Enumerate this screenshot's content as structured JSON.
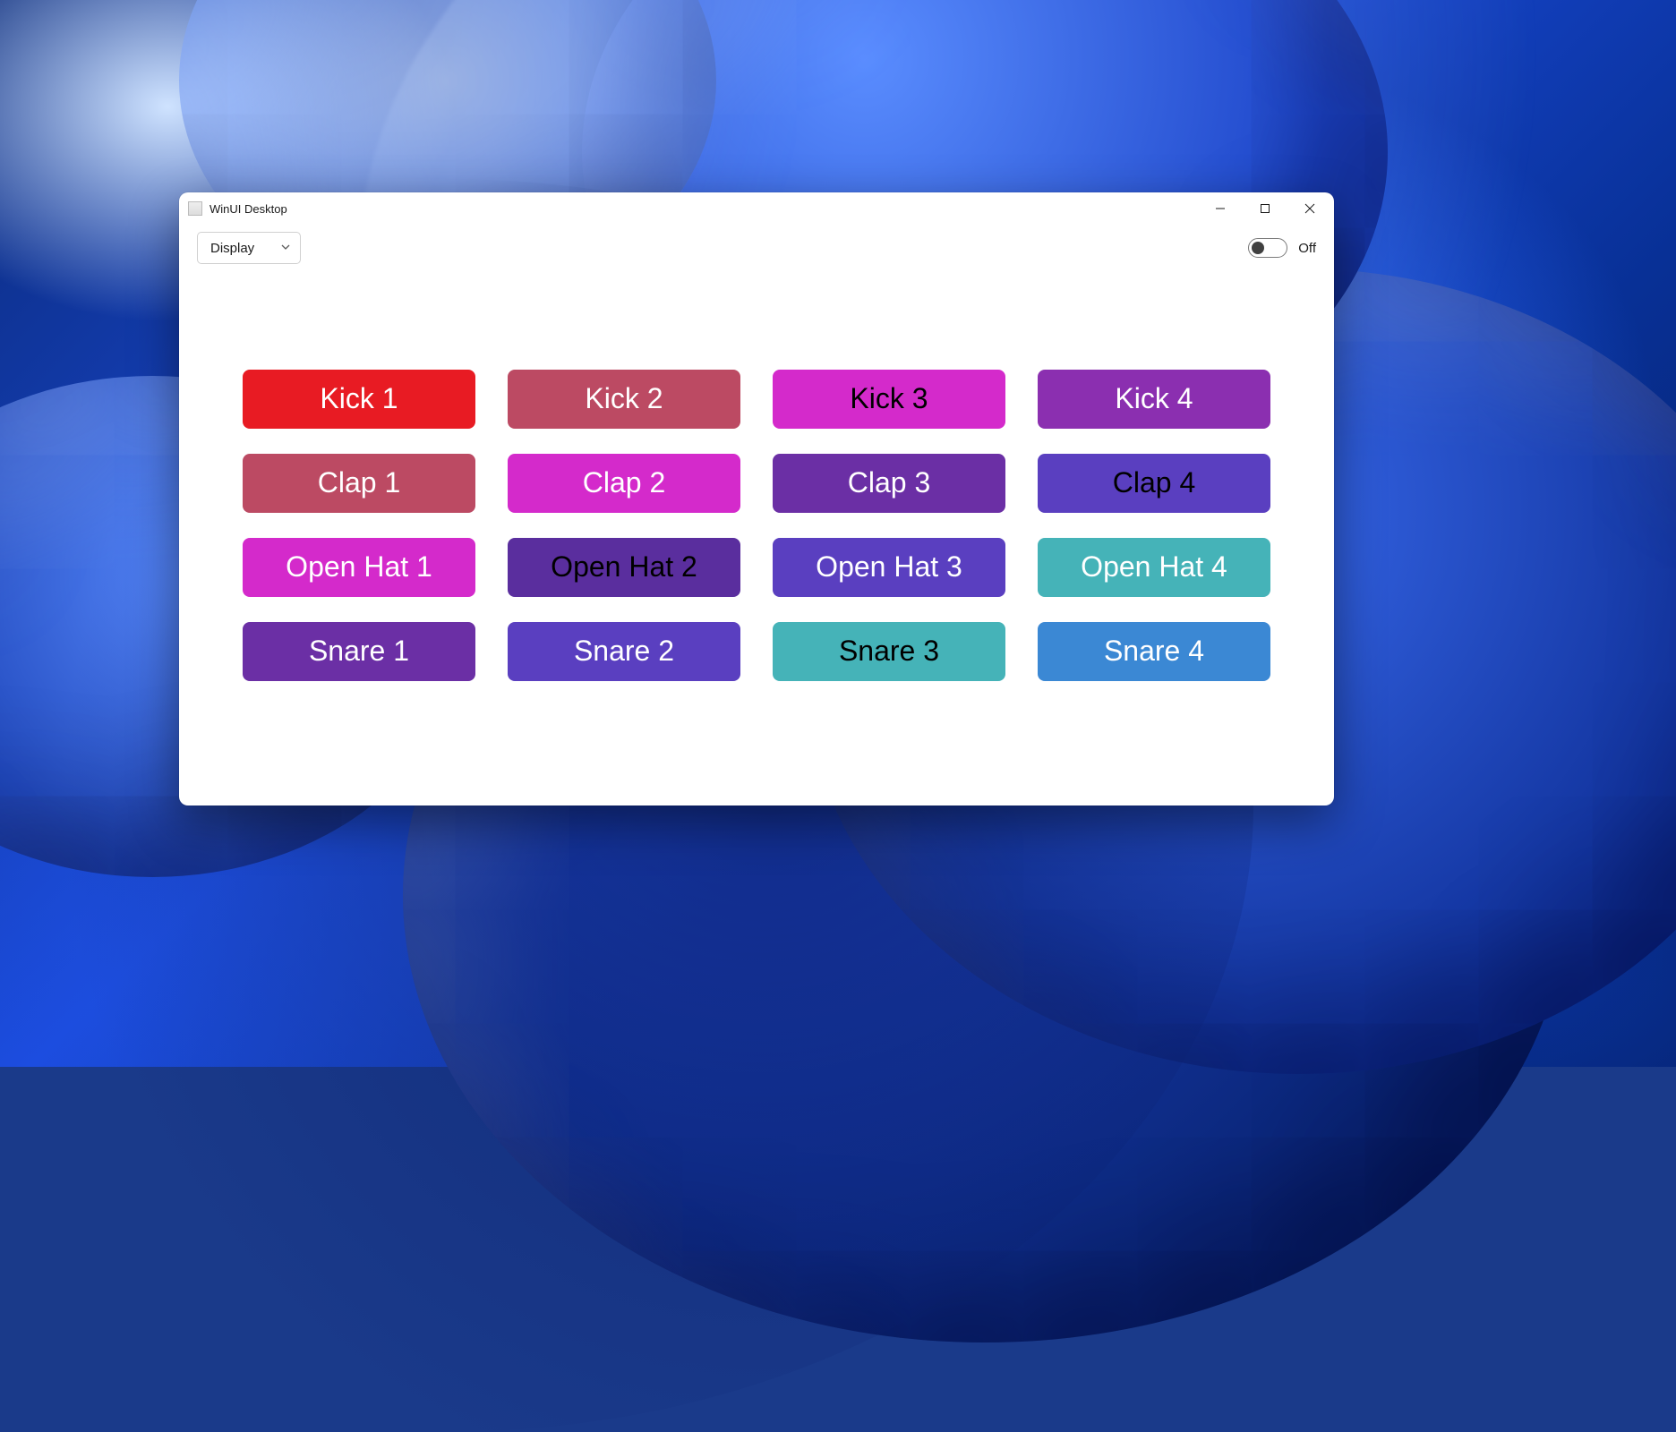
{
  "window": {
    "title": "WinUI Desktop"
  },
  "toolbar": {
    "dropdown_label": "Display",
    "toggle_label": "Off"
  },
  "pads": [
    {
      "label": "Kick 1",
      "bg": "#E81B23",
      "fg": "#FFFFFF"
    },
    {
      "label": "Kick 2",
      "bg": "#BC4A63",
      "fg": "#FFFFFF"
    },
    {
      "label": "Kick 3",
      "bg": "#D42ACB",
      "fg": "#000000"
    },
    {
      "label": "Kick 4",
      "bg": "#8B2FB0",
      "fg": "#FFFFFF"
    },
    {
      "label": "Clap 1",
      "bg": "#BC4A63",
      "fg": "#FFFFFF"
    },
    {
      "label": "Clap 2",
      "bg": "#D42ACB",
      "fg": "#FFFFFF"
    },
    {
      "label": "Clap 3",
      "bg": "#6B2FA5",
      "fg": "#FFFFFF"
    },
    {
      "label": "Clap 4",
      "bg": "#5A3FC0",
      "fg": "#000000"
    },
    {
      "label": "Open Hat 1",
      "bg": "#D42ACB",
      "fg": "#FFFFFF"
    },
    {
      "label": "Open Hat 2",
      "bg": "#5A2E9E",
      "fg": "#000000"
    },
    {
      "label": "Open Hat 3",
      "bg": "#5A3FC0",
      "fg": "#FFFFFF"
    },
    {
      "label": "Open Hat 4",
      "bg": "#45B3B8",
      "fg": "#FFFFFF"
    },
    {
      "label": "Snare 1",
      "bg": "#6B2FA5",
      "fg": "#FFFFFF"
    },
    {
      "label": "Snare 2",
      "bg": "#5A3FC0",
      "fg": "#FFFFFF"
    },
    {
      "label": "Snare 3",
      "bg": "#45B3B8",
      "fg": "#000000"
    },
    {
      "label": "Snare 4",
      "bg": "#3B88D4",
      "fg": "#FFFFFF"
    }
  ]
}
